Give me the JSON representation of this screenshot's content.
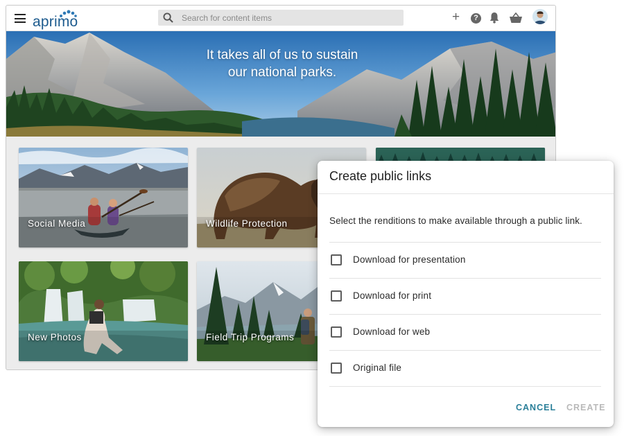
{
  "app": {
    "logo_text": "aprimo",
    "search_placeholder": "Search for content items",
    "help_glyph": "?",
    "plus_glyph": "+",
    "icons": [
      "menu-icon",
      "search-icon",
      "plus-icon",
      "help-icon",
      "bell-icon",
      "basket-icon",
      "avatar"
    ],
    "brand_color": "#1d5b8e"
  },
  "hero": {
    "line1": "It takes all of us to sustain",
    "line2": "our national parks."
  },
  "tiles": [
    {
      "label": "Social Media"
    },
    {
      "label": "Wildlife Protection"
    },
    {
      "label": ""
    },
    {
      "label": "New Photos"
    },
    {
      "label": "Field Trip Programs"
    },
    {
      "label": ""
    }
  ],
  "dialog": {
    "title": "Create public links",
    "description": "Select the renditions to make available through a public link.",
    "options": [
      {
        "label": "Download for presentation",
        "checked": false
      },
      {
        "label": "Download for print",
        "checked": false
      },
      {
        "label": "Download for web",
        "checked": false
      },
      {
        "label": "Original file",
        "checked": false
      }
    ],
    "cancel_label": "CANCEL",
    "create_label": "CREATE",
    "accent_color": "#2a7f99",
    "disabled_color": "#b9b9b9"
  }
}
